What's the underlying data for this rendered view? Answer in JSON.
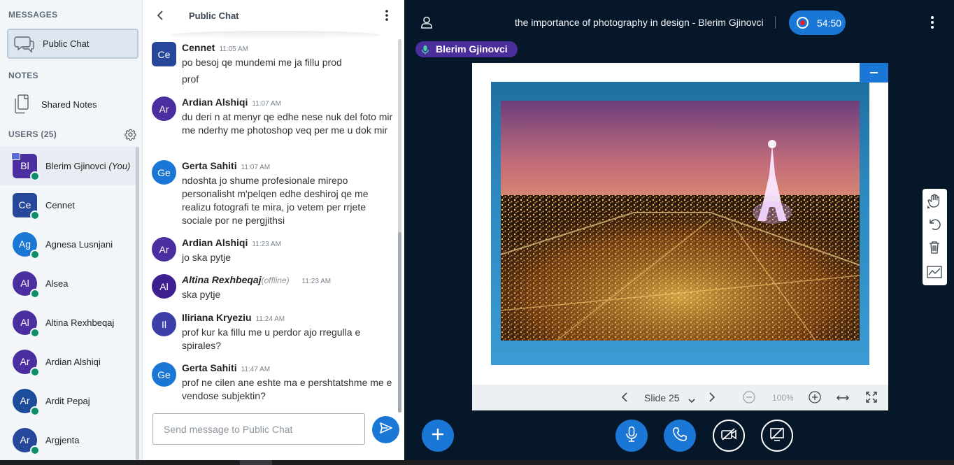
{
  "sidebar": {
    "messages_title": "MESSAGES",
    "public_chat_label": "Public Chat",
    "notes_title": "NOTES",
    "shared_notes_label": "Shared Notes",
    "users_title": "USERS (25)",
    "users": [
      {
        "initials": "Bl",
        "name": "Blerim Gjinovci",
        "suffix": "(You)",
        "color": "#4b2fa0"
      },
      {
        "initials": "Ce",
        "name": "Cennet",
        "suffix": "",
        "color": "#27479b"
      },
      {
        "initials": "Ag",
        "name": "Agnesa Lusnjani",
        "suffix": "",
        "color": "#1b77d6"
      },
      {
        "initials": "Al",
        "name": "Alsea",
        "suffix": "",
        "color": "#4b2fa0"
      },
      {
        "initials": "Al",
        "name": "Altina Rexhbeqaj",
        "suffix": "",
        "color": "#4b2fa0"
      },
      {
        "initials": "Ar",
        "name": "Ardian Alshiqi",
        "suffix": "",
        "color": "#4b2fa0"
      },
      {
        "initials": "Ar",
        "name": "Ardit Pepaj",
        "suffix": "",
        "color": "#1d4c9a"
      },
      {
        "initials": "Ar",
        "name": "Argjenta",
        "suffix": "",
        "color": "#27479b"
      }
    ]
  },
  "chat": {
    "title": "Public Chat",
    "input_placeholder": "Send message to Public Chat",
    "messages": [
      {
        "initials": "Ce",
        "name": "Cennet",
        "time": "11:05 AM",
        "offline": "",
        "color": "#27479b",
        "lines": [
          "po besoj qe mundemi me ja fillu prod",
          "prof"
        ]
      },
      {
        "initials": "Ar",
        "name": "Ardian Alshiqi",
        "time": "11:07 AM",
        "offline": "",
        "color": "#4b2fa0",
        "lines": [
          "du deri n at menyr qe edhe nese nuk del foto mir me nderhy me photoshop veq per me u dok mir"
        ]
      },
      {
        "initials": "Ge",
        "name": "Gerta Sahiti",
        "time": "11:07 AM",
        "offline": "",
        "color": "#1b77d6",
        "lines": [
          "ndoshta jo shume profesionale mirepo personalisht m'pelqen edhe deshiroj qe me realizu fotografi te mira, jo vetem per rrjete sociale por ne pergjithsi"
        ]
      },
      {
        "initials": "Ar",
        "name": "Ardian Alshiqi",
        "time": "11:23 AM",
        "offline": "",
        "color": "#4b2fa0",
        "lines": [
          "jo ska pytje"
        ]
      },
      {
        "initials": "Al",
        "name": "Altina Rexhbeqaj",
        "time": "11:23 AM",
        "offline": "(offline)",
        "color": "#3d1f8f",
        "lines": [
          "ska pytje"
        ]
      },
      {
        "initials": "Il",
        "name": "Iliriana Kryeziu",
        "time": "11:24 AM",
        "offline": "",
        "color": "#3c3fa8",
        "lines": [
          "prof kur ka fillu me u perdor ajo rregulla e spirales?"
        ]
      },
      {
        "initials": "Ge",
        "name": "Gerta Sahiti",
        "time": "11:47 AM",
        "offline": "",
        "color": "#1b77d6",
        "lines": [
          "prof ne cilen ane eshte ma e pershtatshme me e vendose subjektin?"
        ]
      }
    ]
  },
  "main": {
    "meeting_title": "the importance of photography in design - Blerim Gjinovci",
    "recording_time": "54:50",
    "talker_name": "Blerim Gjinovci",
    "slide_label": "Slide 25",
    "zoom_label": "100%"
  },
  "colors": {
    "accent": "#1b77d6",
    "dark_bg": "#06172a",
    "talker_bg": "#4a2e9c",
    "record_red": "#e1202b"
  },
  "icons": [
    "chat-bubbles-icon",
    "notes-icon",
    "gear-icon",
    "chevron-left-icon",
    "kebab-menu-icon",
    "send-icon",
    "user-icon",
    "record-icon",
    "microphone-icon",
    "minimize-icon",
    "chevron-down-icon",
    "chevron-right-icon",
    "zoom-out-icon",
    "zoom-in-icon",
    "fit-width-icon",
    "fullscreen-icon",
    "hand-tool-icon",
    "undo-icon",
    "trash-icon",
    "multi-user-whiteboard-icon",
    "plus-icon",
    "phone-icon",
    "camera-off-icon",
    "screen-share-off-icon"
  ]
}
